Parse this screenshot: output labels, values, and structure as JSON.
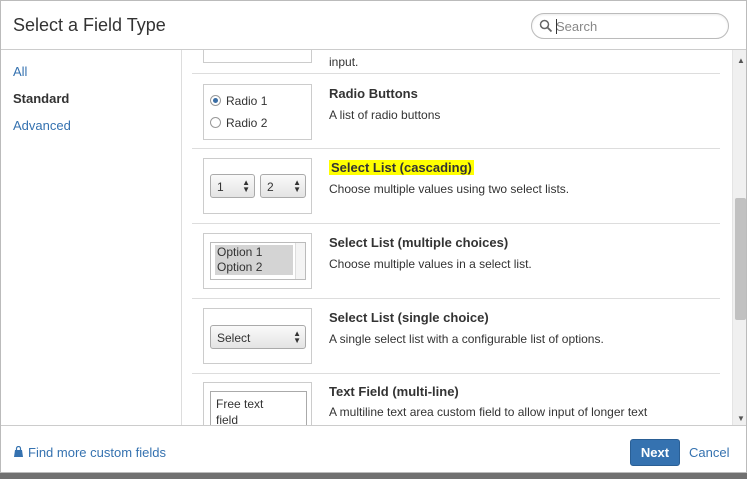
{
  "dialog": {
    "title": "Select a Field Type",
    "search": {
      "placeholder": "Search",
      "value": ""
    }
  },
  "sidebar": {
    "items": [
      {
        "label": "All",
        "state": "link"
      },
      {
        "label": "Standard",
        "state": "selected"
      },
      {
        "label": "Advanced",
        "state": "link"
      }
    ]
  },
  "fields": [
    {
      "title": "",
      "description": "input."
    },
    {
      "title": "Radio Buttons",
      "description": "A list of radio buttons",
      "preview": {
        "options": [
          "Radio 1",
          "Radio 2"
        ],
        "selected": "Radio 1"
      }
    },
    {
      "title": "Select List (cascading)",
      "description": "Choose multiple values using two select lists.",
      "highlighted": true,
      "highlight_color": "#ffff00",
      "preview": {
        "values": [
          "1",
          "2"
        ]
      }
    },
    {
      "title": "Select List (multiple choices)",
      "description": "Choose multiple values in a select list.",
      "preview": {
        "options": [
          "Option 1",
          "Option 2"
        ]
      }
    },
    {
      "title": "Select List (single choice)",
      "description": "A single select list with a configurable list of options.",
      "preview": {
        "value": "Select"
      }
    },
    {
      "title": "Text Field (multi-line)",
      "description": "A multiline text area custom field to allow input of longer text",
      "preview": {
        "lines": [
          "Free text",
          "field"
        ]
      }
    }
  ],
  "footer": {
    "find_more": "Find more custom fields",
    "next": "Next",
    "cancel": "Cancel"
  },
  "colors": {
    "link": "#3572b0",
    "primary_button": "#3572b0",
    "highlight": "#ffff00"
  }
}
